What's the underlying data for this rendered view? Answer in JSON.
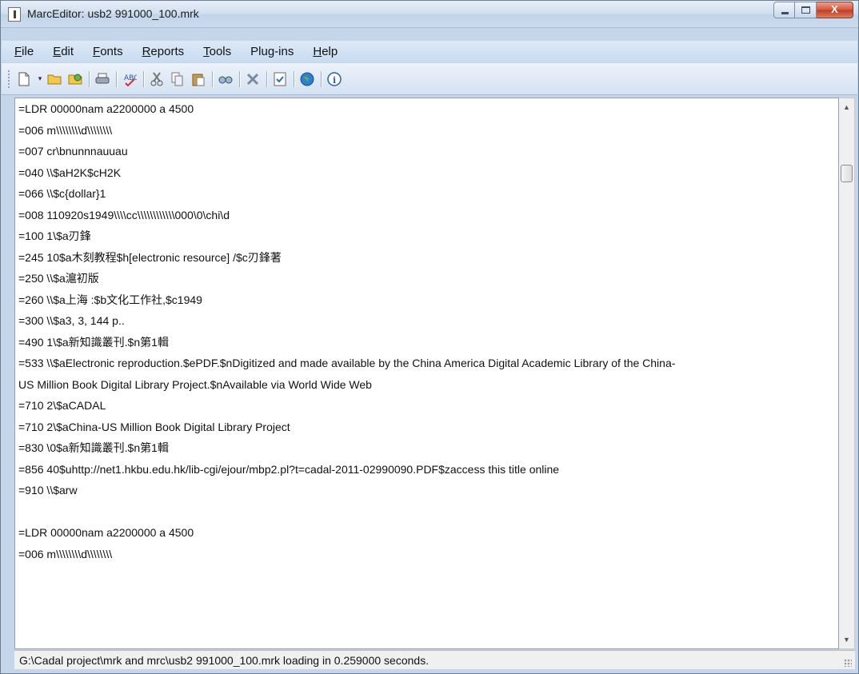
{
  "window": {
    "title": "MarcEditor: usb2 991000_100.mrk",
    "controls": {
      "minimize": "–",
      "maximize": "□",
      "close": "X"
    }
  },
  "menu": {
    "items": [
      "File",
      "Edit",
      "Fonts",
      "Reports",
      "Tools",
      "Plug-ins",
      "Help"
    ]
  },
  "toolbar": {
    "icons": [
      "new-document-icon",
      "dropdown-arrow-icon",
      "open-folder-icon",
      "open-recent-icon",
      "print-icon",
      "spellcheck-icon",
      "cut-icon",
      "copy-icon",
      "paste-icon",
      "find-replace-icon",
      "delete-icon",
      "validate-icon",
      "web-globe-icon",
      "info-icon"
    ]
  },
  "editor": {
    "lines": [
      "=LDR  00000nam a2200000 a 4500",
      "=006  m\\\\\\\\\\\\\\\\d\\\\\\\\\\\\\\\\",
      "=007  cr\\bnunnnauuau",
      "=040  \\\\$aH2K$cH2K",
      "=066  \\\\$c{dollar}1",
      "=008  110920s1949\\\\\\\\cc\\\\\\\\\\\\\\\\\\\\\\\\000\\0\\chi\\d",
      "=100  1\\$a刃鋒",
      "=245  10$a木刻教程$h[electronic resource] /$c刃鋒著",
      "=250  \\\\$a滬初版",
      "=260  \\\\$a上海 :$b文化工作社,$c1949",
      "=300  \\\\$a3, 3, 144 p..",
      "=490  1\\$a新知識叢刊.$n第1輯",
      "=533  \\\\$aElectronic reproduction.$ePDF.$nDigitized and made available by the China America Digital Academic Library of the China-",
      "US Million Book Digital Library Project.$nAvailable via World Wide Web",
      "=710  2\\$aCADAL",
      "=710  2\\$aChina-US Million Book Digital Library Project",
      "=830  \\0$a新知識叢刊.$n第1輯",
      "=856  40$uhttp://net1.hkbu.edu.hk/lib-cgi/ejour/mbp2.pl?t=cadal-2011-02990090.PDF$zaccess this title online",
      "=910  \\\\$arw",
      "",
      "=LDR  00000nam a2200000 a 4500",
      "=006  m\\\\\\\\\\\\\\\\d\\\\\\\\\\\\\\\\"
    ]
  },
  "status": {
    "text": "G:\\Cadal project\\mrk and mrc\\usb2 991000_100.mrk loading in 0.259000 seconds."
  },
  "scrollbar": {
    "position_fraction": 0.1
  }
}
